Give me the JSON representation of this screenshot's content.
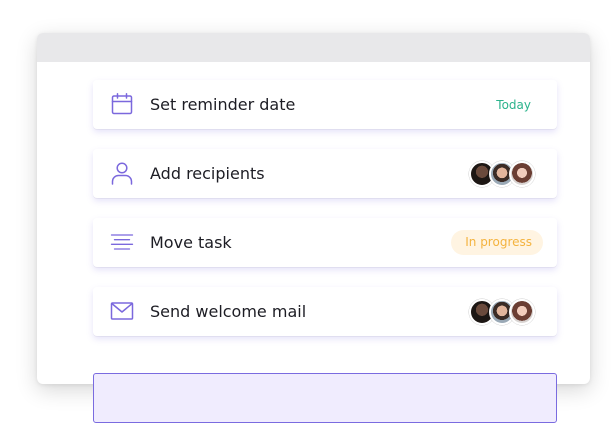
{
  "tasks": [
    {
      "title": "Set reminder date",
      "icon": "calendar-icon",
      "badge": "Today"
    },
    {
      "title": "Add recipients",
      "icon": "user-icon",
      "avatars": [
        "avatar-1",
        "avatar-2",
        "avatar-3"
      ]
    },
    {
      "title": "Move task",
      "icon": "align-lines-icon",
      "badge": "In progress"
    },
    {
      "title": "Send welcome mail",
      "icon": "mail-icon",
      "avatars": [
        "avatar-1",
        "avatar-2",
        "avatar-3"
      ]
    }
  ],
  "colors": {
    "accent": "#7a6be0",
    "icon": "#7b68dd",
    "today": "#2bb38c",
    "progress_text": "#f4b33f",
    "progress_bg": "#fff4e2",
    "input_bg": "#f0ecfe"
  }
}
